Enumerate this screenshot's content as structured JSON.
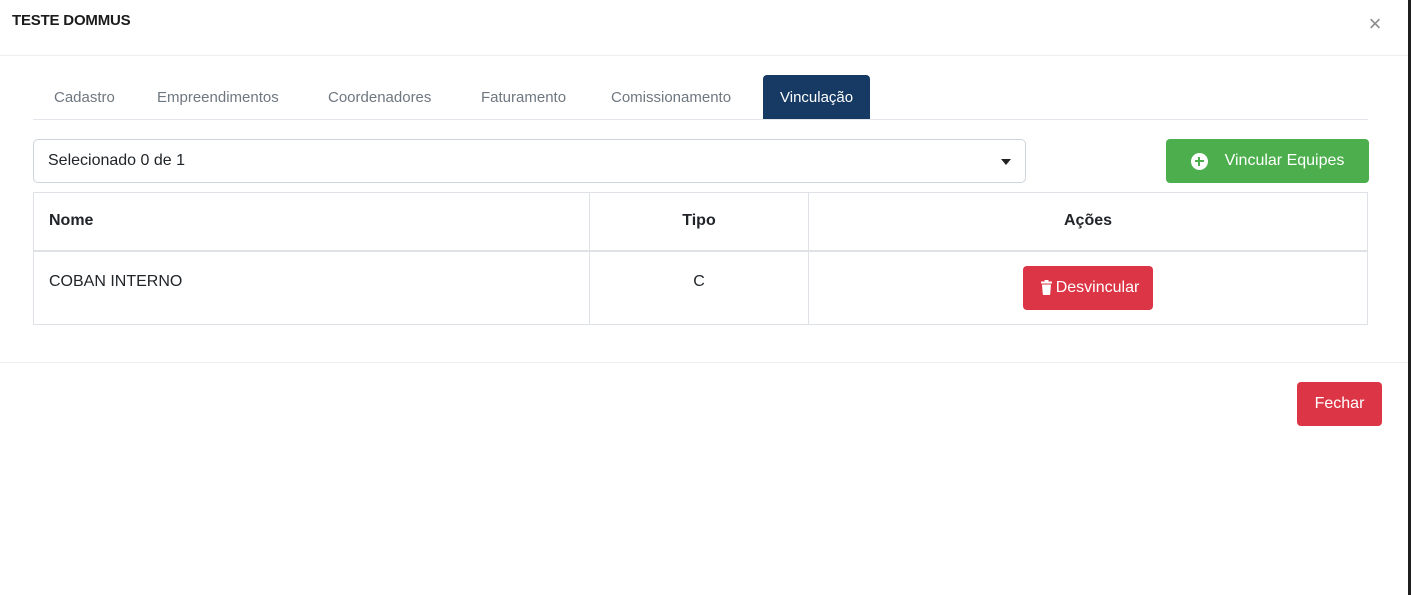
{
  "modal": {
    "title": "TESTE DOMMUS",
    "close_glyph": "×"
  },
  "tabs": [
    {
      "label": "Cadastro",
      "active": false
    },
    {
      "label": "Empreendimentos",
      "active": false
    },
    {
      "label": "Coordenadores",
      "active": false
    },
    {
      "label": "Faturamento",
      "active": false
    },
    {
      "label": "Comissionamento",
      "active": false
    },
    {
      "label": "Vinculação",
      "active": true
    }
  ],
  "selector": {
    "value": "Selecionado 0 de 1",
    "icon": "caret-down-icon"
  },
  "actions": {
    "link_teams_label": "Vincular Equipes",
    "link_teams_icon": "plus-circle-icon"
  },
  "table": {
    "headers": [
      "Nome",
      "Tipo",
      "Ações"
    ],
    "rows": [
      {
        "nome": "COBAN INTERNO",
        "tipo": "C",
        "action_label": "Desvincular",
        "action_icon": "trash-icon"
      }
    ]
  },
  "footer": {
    "close_label": "Fechar"
  },
  "colors": {
    "tab_active": "#163a63",
    "primary_green": "#4cae4c",
    "danger_red": "#dc3545"
  }
}
